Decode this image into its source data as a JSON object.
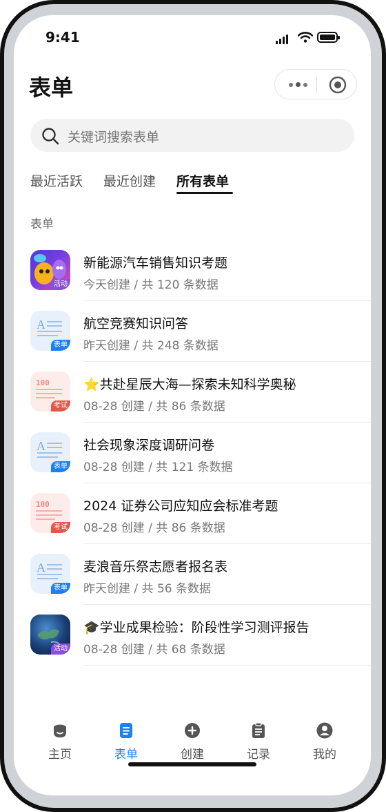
{
  "status": {
    "time": "9:41"
  },
  "header": {
    "title": "表单"
  },
  "search": {
    "placeholder": "关键词搜索表单"
  },
  "tabs": [
    {
      "label": "最近活跃",
      "active": false
    },
    {
      "label": "最近创建",
      "active": false
    },
    {
      "label": "所有表单",
      "active": true
    }
  ],
  "section_label": "表单",
  "forms": [
    {
      "name": "新能源汽车销售知识考题",
      "meta": "今天创建 / 共 120 条数据",
      "icon": "cartoon-thumbnail",
      "badge": "活动"
    },
    {
      "name": "航空竞赛知识问答",
      "meta": "昨天创建 / 共 248 条数据",
      "icon": "form-doc-icon",
      "badge": "表单"
    },
    {
      "name": "⭐共赴星辰大海—探索未知科学奥秘",
      "meta": "08-28 创建 / 共 86 条数据",
      "icon": "exam-paper-icon",
      "badge": "考试"
    },
    {
      "name": "社会现象深度调研问卷",
      "meta": "08-28 创建 / 共 121 条数据",
      "icon": "form-doc-icon",
      "badge": "表单"
    },
    {
      "name": "2024 证券公司应知应会标准考题",
      "meta": "08-28 创建 / 共 86 条数据",
      "icon": "exam-paper-icon",
      "badge": "考试"
    },
    {
      "name": "麦浪音乐祭志愿者报名表",
      "meta": "昨天创建 / 共 56 条数据",
      "icon": "form-doc-icon",
      "badge": "表单"
    },
    {
      "name": "🎓学业成果检验：阶段性学习测评报告",
      "meta": "08-28 创建 / 共 68 条数据",
      "icon": "earth-thumbnail",
      "badge": "活动"
    }
  ],
  "tabbar": [
    {
      "label": "主页",
      "icon": "home-icon",
      "active": false
    },
    {
      "label": "表单",
      "icon": "form-icon",
      "active": true
    },
    {
      "label": "创建",
      "icon": "plus-circle-icon",
      "active": false
    },
    {
      "label": "记录",
      "icon": "clipboard-icon",
      "active": false
    },
    {
      "label": "我的",
      "icon": "user-icon",
      "active": false
    }
  ],
  "colors": {
    "accent": "#1d7ff3",
    "form_badge": "#1d7ff3",
    "exam_badge": "#e2574c",
    "event_badge": "#8a4fe0"
  }
}
